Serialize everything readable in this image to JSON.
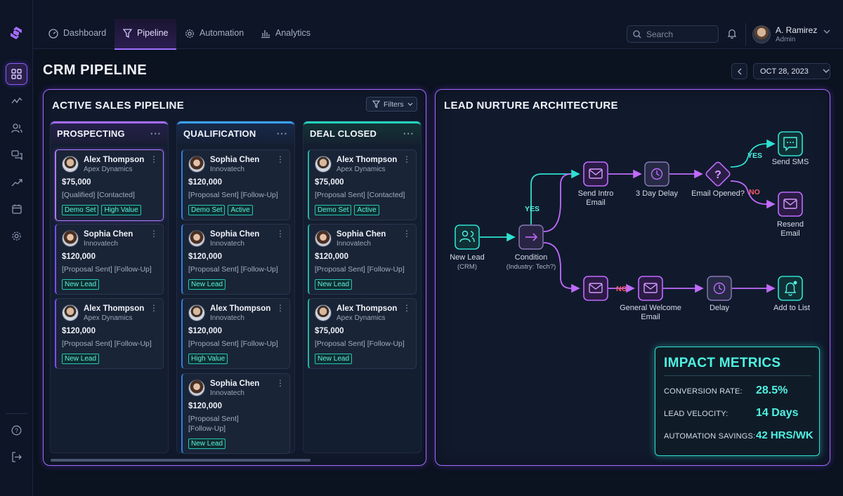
{
  "nav": {
    "tabs": [
      {
        "label": "Dashboard",
        "icon": "dashboard-gauge-icon"
      },
      {
        "label": "Pipeline",
        "icon": "funnel-icon",
        "active": true
      },
      {
        "label": "Automation",
        "icon": "gear-icon"
      },
      {
        "label": "Analytics",
        "icon": "bar-chart-icon"
      }
    ],
    "search_placeholder": "Search",
    "user": {
      "name": "A. Ramirez",
      "role": "Admin"
    }
  },
  "sidebar": {
    "items": [
      "grid-icon",
      "activity-icon",
      "users-icon",
      "chat-icon",
      "trend-icon",
      "calendar-icon",
      "gear-icon"
    ],
    "bottom": [
      "help-icon",
      "logout-icon"
    ]
  },
  "page": {
    "title": "CRM PIPELINE",
    "date": "OCT 28, 2023"
  },
  "pipeline": {
    "title": "ACTIVE SALES PIPELINE",
    "filters_label": "Filters",
    "columns": [
      {
        "title": "PROSPECTING",
        "cards": [
          {
            "name": "Alex Thompson",
            "company": "Apex Dynamics",
            "amount": "$75,000",
            "status": "[Qualified] [Contacted]",
            "tags": [
              "Demo Set",
              "High Value"
            ]
          },
          {
            "name": "Sophia Chen",
            "company": "Innovatech",
            "amount": "$120,000",
            "status": "[Proposal Sent] [Follow-Up]",
            "tags": [
              "New Lead"
            ]
          },
          {
            "name": "Alex Thompson",
            "company": "Apex Dynamics",
            "amount": "$120,000",
            "status": "[Proposal Sent] [Follow-Up]",
            "tags": [
              "New Lead"
            ]
          }
        ]
      },
      {
        "title": "QUALIFICATION",
        "cards": [
          {
            "name": "Sophia Chen",
            "company": "Innovatech",
            "amount": "$120,000",
            "status": "[Proposal Sent] [Follow-Up]",
            "tags": [
              "Demo Set",
              "Active"
            ]
          },
          {
            "name": "Sophia Chen",
            "company": "Innovatech",
            "amount": "$120,000",
            "status": "[Proposal Sent] [Follow-Up]",
            "tags": [
              "New Lead"
            ]
          },
          {
            "name": "Alex Thompson",
            "company": "Innovatech",
            "amount": "$120,000",
            "status": "[Proposal Sent] [Follow-Up]",
            "tags": [
              "High Value"
            ]
          },
          {
            "name": "Sophia Chen",
            "company": "Innovatech",
            "amount": "$120,000",
            "status": "[Proposal Sent] [Follow-Up]",
            "tags": [
              "New Lead"
            ]
          }
        ]
      },
      {
        "title": "DEAL CLOSED",
        "cards": [
          {
            "name": "Alex Thompson",
            "company": "Apex Dynamics",
            "amount": "$75,000",
            "status": "[Proposal Sent] [Contacted]",
            "tags": [
              "Demo Set",
              "Active"
            ]
          },
          {
            "name": "Sophia Chen",
            "company": "Innovatech",
            "amount": "$120,000",
            "status": "[Proposal Sent] [Follow-Up]",
            "tags": [
              "New Lead"
            ]
          },
          {
            "name": "Alex Thompson",
            "company": "Apex Dynamics",
            "amount": "$75,000",
            "status": "[Proposal Sent] [Follow-Up]",
            "tags": [
              "New Lead"
            ]
          }
        ]
      }
    ]
  },
  "architecture": {
    "title": "LEAD NURTURE ARCHITECTURE",
    "nodes": {
      "new_lead": "New Lead",
      "new_lead_sub": "(CRM)",
      "condition": "Condition",
      "condition_sub": "(Industry: Tech?)",
      "send_intro": "Send Intro Email",
      "delay3": "3 Day Delay",
      "email_opened": "Email Opened?",
      "send_sms": "Send SMS",
      "resend": "Resend Email",
      "general_welcome": "General Welcome Email",
      "delay": "Delay",
      "add_to_list": "Add to List"
    },
    "edge_labels": {
      "yes1": "YES",
      "yes2": "YES",
      "no1": "NO",
      "no2": "NO"
    }
  },
  "metrics": {
    "title": "IMPACT METRICS",
    "rows": [
      {
        "label": "CONVERSION RATE:",
        "value": "28.5%"
      },
      {
        "label": "LEAD VELOCITY:",
        "value": "14 Days"
      },
      {
        "label": "AUTOMATION SAVINGS:",
        "value": "42 HRS/WK"
      }
    ]
  },
  "colors": {
    "purple": "#a56cff",
    "teal": "#2fe0d0",
    "blue": "#3aa0ff",
    "red": "#ff5a6a"
  }
}
